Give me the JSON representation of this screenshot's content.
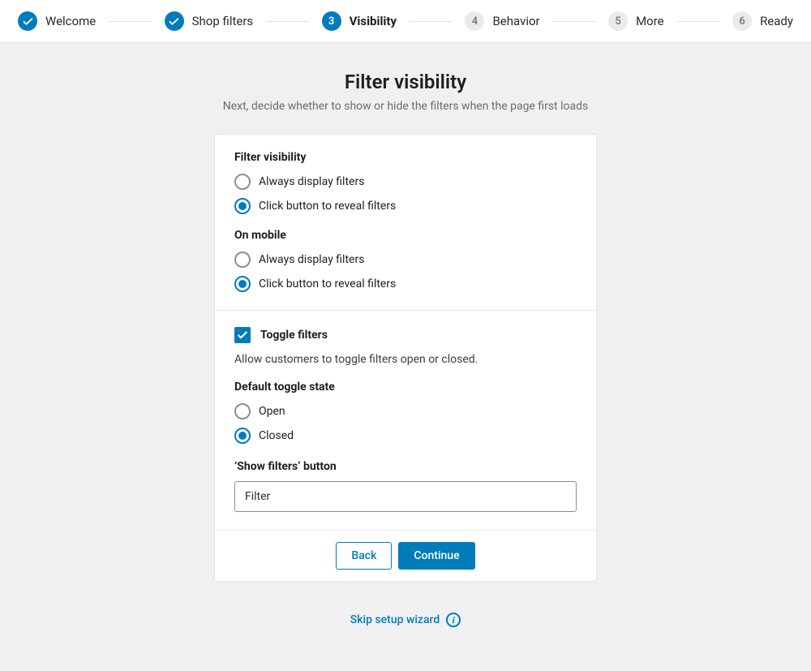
{
  "stepper": [
    {
      "label": "Welcome",
      "state": "done",
      "num": "1"
    },
    {
      "label": "Shop filters",
      "state": "done",
      "num": "2"
    },
    {
      "label": "Visibility",
      "state": "current",
      "num": "3"
    },
    {
      "label": "Behavior",
      "state": "future",
      "num": "4"
    },
    {
      "label": "More",
      "state": "future",
      "num": "5"
    },
    {
      "label": "Ready",
      "state": "future",
      "num": "6"
    }
  ],
  "head": {
    "title": "Filter visibility",
    "subtitle": "Next, decide whether to show or hide the filters when the page first loads"
  },
  "section1": {
    "group1_title": "Filter visibility",
    "group1_opts": [
      {
        "label": "Always display filters",
        "checked": false
      },
      {
        "label": "Click button to reveal filters",
        "checked": true
      }
    ],
    "group2_title": "On mobile",
    "group2_opts": [
      {
        "label": "Always display filters",
        "checked": false
      },
      {
        "label": "Click button to reveal filters",
        "checked": true
      }
    ]
  },
  "section2": {
    "toggle_label": "Toggle filters",
    "toggle_checked": true,
    "toggle_desc": "Allow customers to toggle filters open or closed.",
    "default_state_title": "Default toggle state",
    "default_state_opts": [
      {
        "label": "Open",
        "checked": false
      },
      {
        "label": "Closed",
        "checked": true
      }
    ],
    "show_button_label": "‘Show filters’ button",
    "show_button_value": "Filter"
  },
  "footer": {
    "back": "Back",
    "continue": "Continue"
  },
  "skip": {
    "label": "Skip setup wizard"
  }
}
